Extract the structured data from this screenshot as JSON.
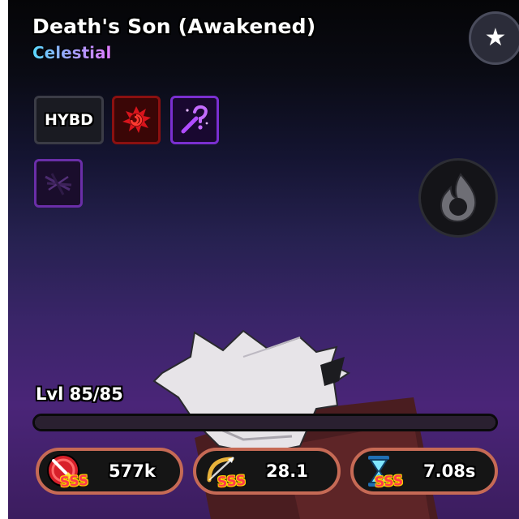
{
  "unit": {
    "name": "Death's Son (Awakened)",
    "rarity": "Celestial",
    "rarity_gradient": [
      "#5ad9ff",
      "#e07bff"
    ]
  },
  "favorite_button": {
    "icon": "star-icon"
  },
  "traits": [
    {
      "label": "HYBD",
      "icon": "hybrid-text-badge"
    },
    {
      "icon": "red-swirl-fire-icon",
      "color": "#8b1010"
    },
    {
      "icon": "purple-question-wand-icon",
      "color": "#7a2fd0"
    },
    {
      "icon": "shadow-claw-icon",
      "color": "#6a2ea8"
    }
  ],
  "element_orb": {
    "icon": "dark-flame-icon"
  },
  "level": {
    "label": "Lvl 85/85",
    "current": 85,
    "max": 85
  },
  "stats": {
    "damage": {
      "icon": "sword-icon",
      "grade": "SSS",
      "value": "577k"
    },
    "range": {
      "icon": "bow-icon",
      "grade": "SSS",
      "value": "28.1"
    },
    "spa": {
      "icon": "hourglass-icon",
      "grade": "SSS",
      "value": "7.08s"
    }
  },
  "colors": {
    "stat_border": "#c66a55",
    "grade_text": "#ff3b4a",
    "grade_outline": "#ffd400"
  }
}
